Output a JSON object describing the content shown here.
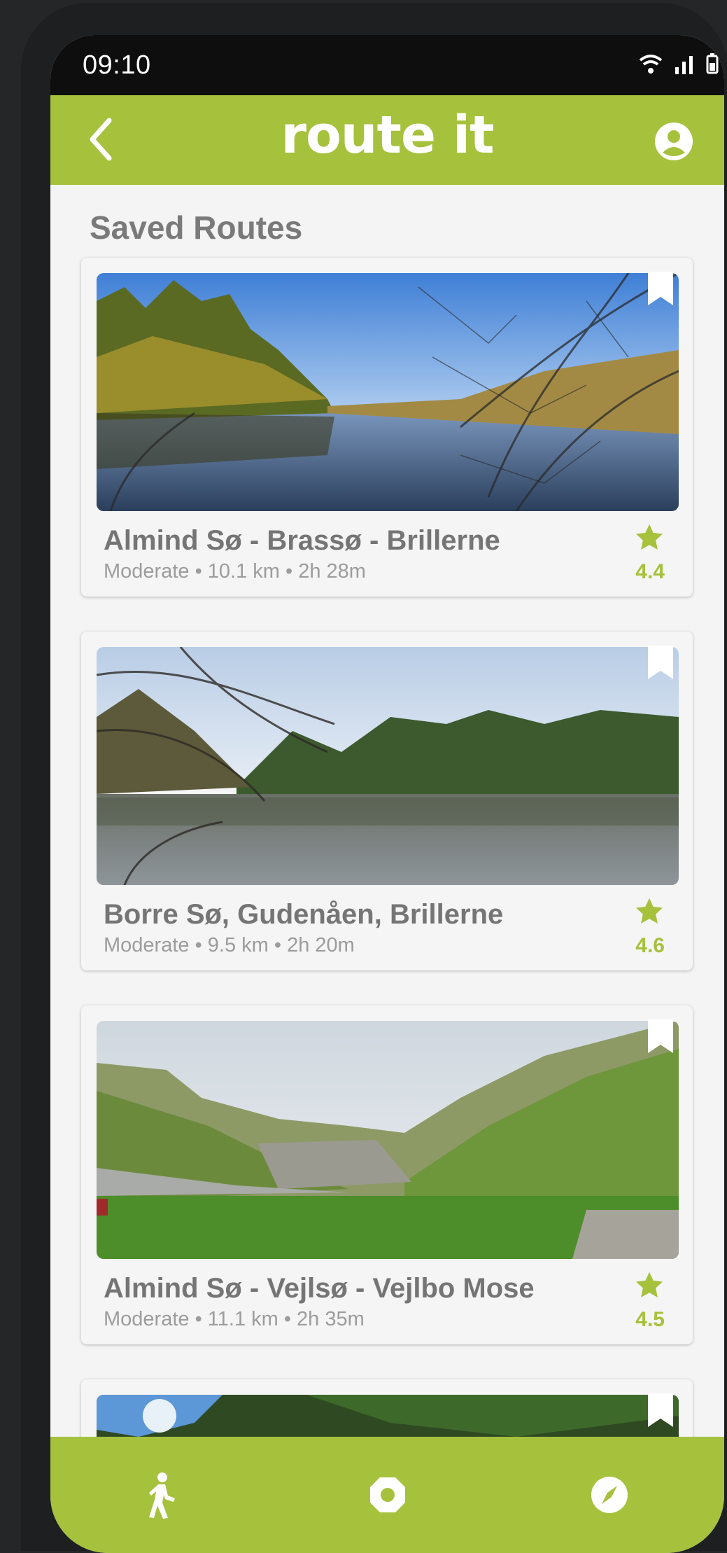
{
  "status": {
    "time": "09:10"
  },
  "app": {
    "title": "route it",
    "accent": "#a6c13c"
  },
  "section": {
    "title": "Saved Routes"
  },
  "routes": [
    {
      "name": "Almind Sø - Brassø - Brillerne",
      "meta": "Moderate • 10.1 km • 2h 28m",
      "rating": "4.4",
      "saved": true
    },
    {
      "name": "Borre Sø, Gudenåen, Brillerne",
      "meta": "Moderate • 9.5 km • 2h 20m",
      "rating": "4.6",
      "saved": true
    },
    {
      "name": "Almind Sø - Vejlsø - Vejlbo Mose",
      "meta": "Moderate • 11.1 km • 2h 35m",
      "rating": "4.5",
      "saved": true
    }
  ],
  "icons": {
    "back": "chevron-left-icon",
    "profile": "account-circle-icon",
    "bookmark": "bookmark-icon",
    "star": "star-icon",
    "nav": [
      "hiking-icon",
      "octagon-icon",
      "compass-icon"
    ]
  }
}
